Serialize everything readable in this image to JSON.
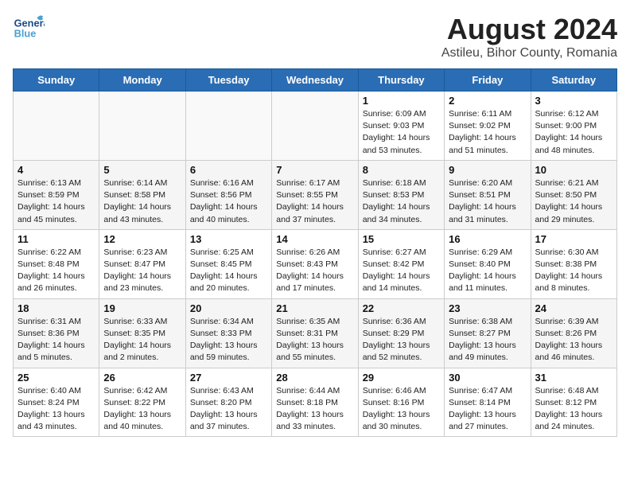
{
  "header": {
    "logo_line1": "General",
    "logo_line2": "Blue",
    "title": "August 2024",
    "subtitle": "Astileu, Bihor County, Romania"
  },
  "days_of_week": [
    "Sunday",
    "Monday",
    "Tuesday",
    "Wednesday",
    "Thursday",
    "Friday",
    "Saturday"
  ],
  "weeks": [
    [
      {
        "day": "",
        "info": ""
      },
      {
        "day": "",
        "info": ""
      },
      {
        "day": "",
        "info": ""
      },
      {
        "day": "",
        "info": ""
      },
      {
        "day": "1",
        "info": "Sunrise: 6:09 AM\nSunset: 9:03 PM\nDaylight: 14 hours\nand 53 minutes."
      },
      {
        "day": "2",
        "info": "Sunrise: 6:11 AM\nSunset: 9:02 PM\nDaylight: 14 hours\nand 51 minutes."
      },
      {
        "day": "3",
        "info": "Sunrise: 6:12 AM\nSunset: 9:00 PM\nDaylight: 14 hours\nand 48 minutes."
      }
    ],
    [
      {
        "day": "4",
        "info": "Sunrise: 6:13 AM\nSunset: 8:59 PM\nDaylight: 14 hours\nand 45 minutes."
      },
      {
        "day": "5",
        "info": "Sunrise: 6:14 AM\nSunset: 8:58 PM\nDaylight: 14 hours\nand 43 minutes."
      },
      {
        "day": "6",
        "info": "Sunrise: 6:16 AM\nSunset: 8:56 PM\nDaylight: 14 hours\nand 40 minutes."
      },
      {
        "day": "7",
        "info": "Sunrise: 6:17 AM\nSunset: 8:55 PM\nDaylight: 14 hours\nand 37 minutes."
      },
      {
        "day": "8",
        "info": "Sunrise: 6:18 AM\nSunset: 8:53 PM\nDaylight: 14 hours\nand 34 minutes."
      },
      {
        "day": "9",
        "info": "Sunrise: 6:20 AM\nSunset: 8:51 PM\nDaylight: 14 hours\nand 31 minutes."
      },
      {
        "day": "10",
        "info": "Sunrise: 6:21 AM\nSunset: 8:50 PM\nDaylight: 14 hours\nand 29 minutes."
      }
    ],
    [
      {
        "day": "11",
        "info": "Sunrise: 6:22 AM\nSunset: 8:48 PM\nDaylight: 14 hours\nand 26 minutes."
      },
      {
        "day": "12",
        "info": "Sunrise: 6:23 AM\nSunset: 8:47 PM\nDaylight: 14 hours\nand 23 minutes."
      },
      {
        "day": "13",
        "info": "Sunrise: 6:25 AM\nSunset: 8:45 PM\nDaylight: 14 hours\nand 20 minutes."
      },
      {
        "day": "14",
        "info": "Sunrise: 6:26 AM\nSunset: 8:43 PM\nDaylight: 14 hours\nand 17 minutes."
      },
      {
        "day": "15",
        "info": "Sunrise: 6:27 AM\nSunset: 8:42 PM\nDaylight: 14 hours\nand 14 minutes."
      },
      {
        "day": "16",
        "info": "Sunrise: 6:29 AM\nSunset: 8:40 PM\nDaylight: 14 hours\nand 11 minutes."
      },
      {
        "day": "17",
        "info": "Sunrise: 6:30 AM\nSunset: 8:38 PM\nDaylight: 14 hours\nand 8 minutes."
      }
    ],
    [
      {
        "day": "18",
        "info": "Sunrise: 6:31 AM\nSunset: 8:36 PM\nDaylight: 14 hours\nand 5 minutes."
      },
      {
        "day": "19",
        "info": "Sunrise: 6:33 AM\nSunset: 8:35 PM\nDaylight: 14 hours\nand 2 minutes."
      },
      {
        "day": "20",
        "info": "Sunrise: 6:34 AM\nSunset: 8:33 PM\nDaylight: 13 hours\nand 59 minutes."
      },
      {
        "day": "21",
        "info": "Sunrise: 6:35 AM\nSunset: 8:31 PM\nDaylight: 13 hours\nand 55 minutes."
      },
      {
        "day": "22",
        "info": "Sunrise: 6:36 AM\nSunset: 8:29 PM\nDaylight: 13 hours\nand 52 minutes."
      },
      {
        "day": "23",
        "info": "Sunrise: 6:38 AM\nSunset: 8:27 PM\nDaylight: 13 hours\nand 49 minutes."
      },
      {
        "day": "24",
        "info": "Sunrise: 6:39 AM\nSunset: 8:26 PM\nDaylight: 13 hours\nand 46 minutes."
      }
    ],
    [
      {
        "day": "25",
        "info": "Sunrise: 6:40 AM\nSunset: 8:24 PM\nDaylight: 13 hours\nand 43 minutes."
      },
      {
        "day": "26",
        "info": "Sunrise: 6:42 AM\nSunset: 8:22 PM\nDaylight: 13 hours\nand 40 minutes."
      },
      {
        "day": "27",
        "info": "Sunrise: 6:43 AM\nSunset: 8:20 PM\nDaylight: 13 hours\nand 37 minutes."
      },
      {
        "day": "28",
        "info": "Sunrise: 6:44 AM\nSunset: 8:18 PM\nDaylight: 13 hours\nand 33 minutes."
      },
      {
        "day": "29",
        "info": "Sunrise: 6:46 AM\nSunset: 8:16 PM\nDaylight: 13 hours\nand 30 minutes."
      },
      {
        "day": "30",
        "info": "Sunrise: 6:47 AM\nSunset: 8:14 PM\nDaylight: 13 hours\nand 27 minutes."
      },
      {
        "day": "31",
        "info": "Sunrise: 6:48 AM\nSunset: 8:12 PM\nDaylight: 13 hours\nand 24 minutes."
      }
    ]
  ]
}
